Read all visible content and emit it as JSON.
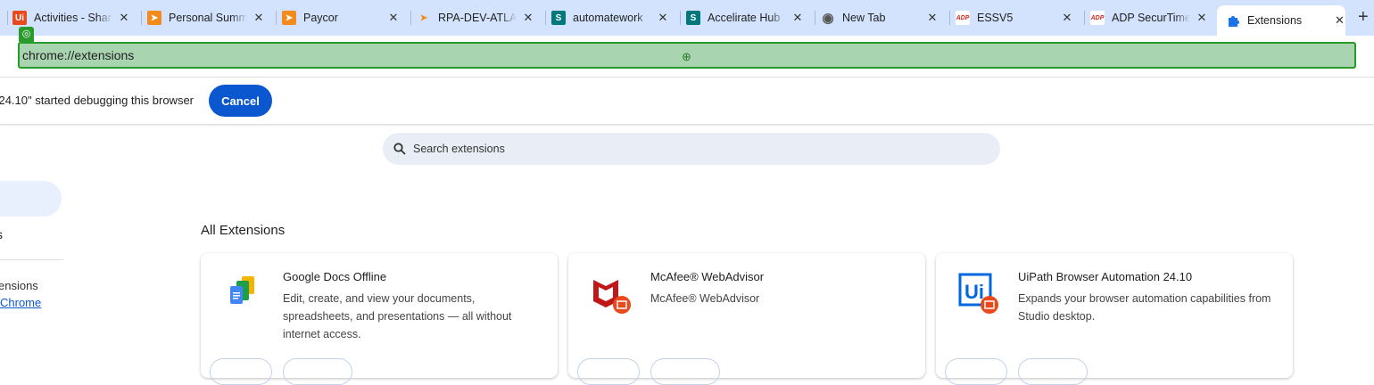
{
  "tabs": [
    {
      "label": "Activities - SharePoint",
      "icon": "uipath-icon",
      "color": "#e8491d"
    },
    {
      "label": "Personal Summary",
      "icon": "paycor-icon",
      "color": "#f38b1c"
    },
    {
      "label": "Paycor",
      "icon": "paycor-icon",
      "color": "#f38b1c"
    },
    {
      "label": "RPA-DEV-ATLAS",
      "icon": "paycor-arrow-icon",
      "color": "#f38b1c"
    },
    {
      "label": "automatework",
      "icon": "sharepoint-icon",
      "color": "#03787c"
    },
    {
      "label": "Accelirate Hub",
      "icon": "sharepoint-icon",
      "color": "#03787c"
    },
    {
      "label": "New Tab",
      "icon": "chrome-icon",
      "color": "#555555"
    },
    {
      "label": "ESSV5",
      "icon": "adp-icon",
      "color": "#d0271d"
    },
    {
      "label": "ADP SecurTime",
      "icon": "adp-icon",
      "color": "#d0271d"
    }
  ],
  "active_tab": {
    "label": "Extensions",
    "icon": "puzzle-icon",
    "color": "#1a73e8"
  },
  "address": {
    "url": "chrome://extensions",
    "left_fragment": "e"
  },
  "infobar": {
    "text": "24.10\" started debugging this browser",
    "cancel": "Cancel"
  },
  "search": {
    "placeholder": "Search extensions"
  },
  "sidebar": {
    "item_fragment": "s",
    "text_fragment": "ensions",
    "link_fragment": "Chrome"
  },
  "section_title": "All Extensions",
  "extensions": [
    {
      "name": "Google Docs Offline",
      "description": "Edit, create, and view your documents, spreadsheets, and presentations — all without internet access."
    },
    {
      "name": "McAfee® WebAdvisor",
      "description": "McAfee® WebAdvisor"
    },
    {
      "name": "UiPath Browser Automation 24.10",
      "description": "Expands your browser automation capabilities from Studio desktop."
    }
  ]
}
